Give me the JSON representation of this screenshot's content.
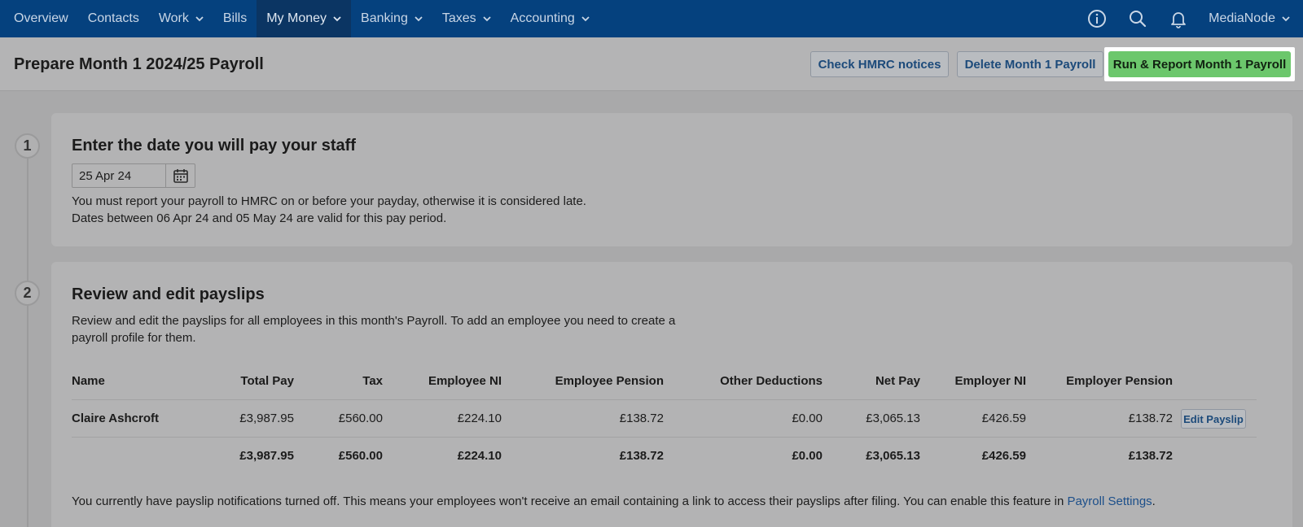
{
  "nav": {
    "items": [
      {
        "label": "Overview",
        "dropdown": false,
        "active": false
      },
      {
        "label": "Contacts",
        "dropdown": false,
        "active": false
      },
      {
        "label": "Work",
        "dropdown": true,
        "active": false
      },
      {
        "label": "Bills",
        "dropdown": false,
        "active": false
      },
      {
        "label": "My Money",
        "dropdown": true,
        "active": true
      },
      {
        "label": "Banking",
        "dropdown": true,
        "active": false
      },
      {
        "label": "Taxes",
        "dropdown": true,
        "active": false
      },
      {
        "label": "Accounting",
        "dropdown": true,
        "active": false
      }
    ],
    "icons": [
      "info-icon",
      "search-icon",
      "bell-icon"
    ],
    "user": "MediaNode"
  },
  "header": {
    "title": "Prepare Month 1 2024/25 Payroll",
    "check_hmrc_label": "Check HMRC notices",
    "delete_label": "Delete Month 1 Payroll",
    "run_label": "Run & Report Month 1 Payroll"
  },
  "step1": {
    "number": "1",
    "title": "Enter the date you will pay your staff",
    "date_value": "25 Apr 24",
    "note1": "You must report your payroll to HMRC on or before your payday, otherwise it is considered late.",
    "note2": "Dates between 06 Apr 24 and 05 May 24 are valid for this pay period."
  },
  "step2": {
    "number": "2",
    "title": "Review and edit payslips",
    "desc1": "Review and edit the payslips for all employees in this month's Payroll. To add an employee you need to create a",
    "desc2": "payroll profile for them.",
    "headers": [
      "Name",
      "Total Pay",
      "Tax",
      "Employee NI",
      "Employee Pension",
      "Other Deductions",
      "Net Pay",
      "Employer NI",
      "Employer Pension"
    ],
    "rows": [
      {
        "name": "Claire Ashcroft",
        "total_pay": "£3,987.95",
        "tax": "£560.00",
        "employee_ni": "£224.10",
        "employee_pension": "£138.72",
        "other_deductions": "£0.00",
        "net_pay": "£3,065.13",
        "employer_ni": "£426.59",
        "employer_pension": "£138.72",
        "action": "Edit Payslip"
      }
    ],
    "totals": {
      "total_pay": "£3,987.95",
      "tax": "£560.00",
      "employee_ni": "£224.10",
      "employee_pension": "£138.72",
      "other_deductions": "£0.00",
      "net_pay": "£3,065.13",
      "employer_ni": "£426.59",
      "employer_pension": "£138.72"
    },
    "notice_text": "You currently have payslip notifications turned off. This means your employees won't receive an email containing a link to access their payslips after filing. You can enable this feature in ",
    "notice_link": "Payroll Settings",
    "notice_end": "."
  },
  "colors": {
    "nav_bg": "#05417e",
    "primary_button": "#6cc76c",
    "link": "#1c4f8a"
  }
}
